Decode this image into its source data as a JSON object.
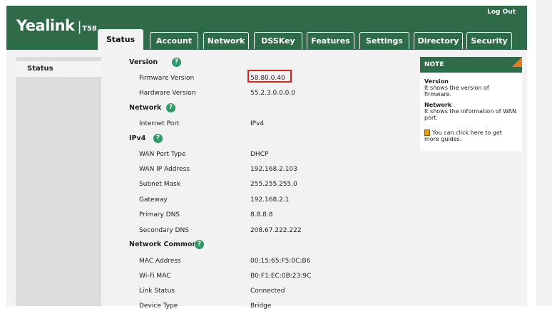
{
  "header": {
    "brand": "Yealink",
    "separator": "|",
    "model": "T58",
    "logout_label": "Log Out"
  },
  "tabs": [
    {
      "label": "Status",
      "active": true
    },
    {
      "label": "Account"
    },
    {
      "label": "Network"
    },
    {
      "label": "DSSKey"
    },
    {
      "label": "Features"
    },
    {
      "label": "Settings"
    },
    {
      "label": "Directory"
    },
    {
      "label": "Security"
    }
  ],
  "sidebar": {
    "items": [
      {
        "label": "Status"
      }
    ]
  },
  "main": {
    "sections": [
      {
        "title": "Version",
        "rows": [
          {
            "label": "Firmware Version",
            "value": "58.80.0.40",
            "highlighted": true
          },
          {
            "label": "Hardware Version",
            "value": "55.2.3.0.0.0.0"
          }
        ]
      },
      {
        "title": "Network",
        "rows": [
          {
            "label": "Internet Port",
            "value": "IPv4"
          }
        ]
      },
      {
        "title": "IPv4",
        "rows": [
          {
            "label": "WAN Port Type",
            "value": "DHCP"
          },
          {
            "label": "WAN IP Address",
            "value": "192.168.2.103"
          },
          {
            "label": "Subnet Mask",
            "value": "255.255.255.0"
          },
          {
            "label": "Gateway",
            "value": "192.168.2.1"
          },
          {
            "label": "Primary DNS",
            "value": "8.8.8.8"
          },
          {
            "label": "Secondary DNS",
            "value": "208.67.222.222"
          }
        ]
      },
      {
        "title": "Network Common",
        "rows": [
          {
            "label": "MAC Address",
            "value": "00:15:65:F5:0C:B6"
          },
          {
            "label": "Wi-Fi MAC",
            "value": "B0:F1:EC:0B:23:9C"
          },
          {
            "label": "Link Status",
            "value": "Connected"
          },
          {
            "label": "Device Type",
            "value": "Bridge"
          }
        ]
      }
    ],
    "help_icon": "?"
  },
  "note": {
    "title": "NOTE",
    "version_title": "Version",
    "version_text": "It shows the version of firmware.",
    "network_title": "Network",
    "network_text": "It shows the information of WAN port.",
    "guide_text": "You can click here to get more guides."
  },
  "colors": {
    "brand_green": "#2f6b48",
    "help_green": "#2f9a66",
    "highlight_red": "#e0201e",
    "note_corner": "#e87a23"
  }
}
